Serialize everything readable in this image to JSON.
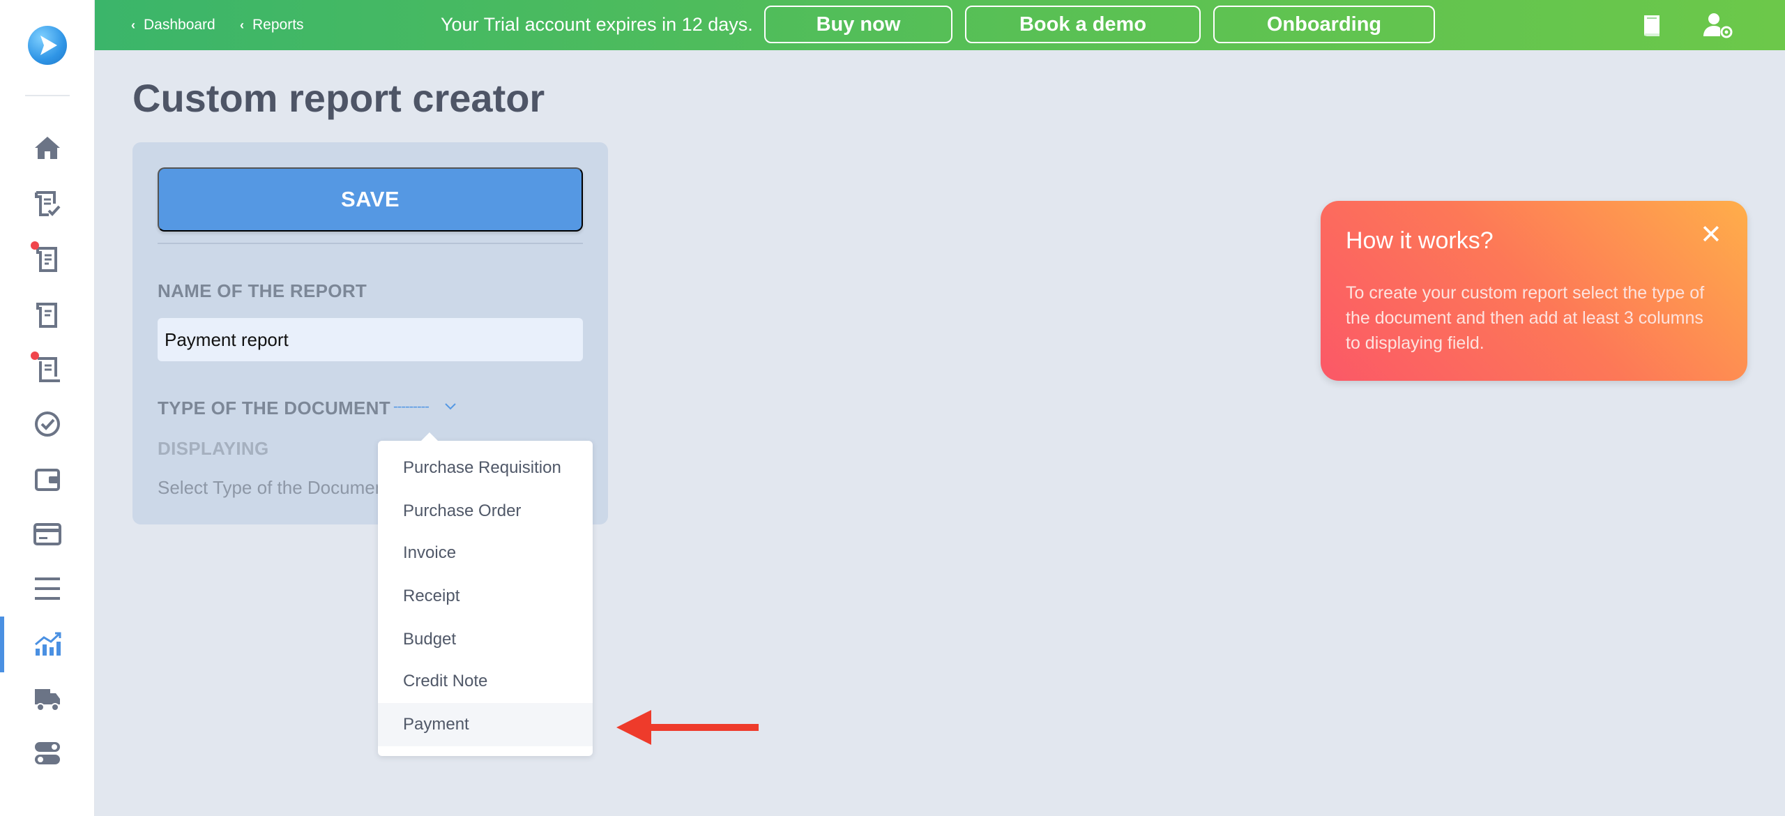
{
  "topbar": {
    "crumbs": [
      "Dashboard",
      "Reports"
    ],
    "trial_text": "Your Trial account expires in 12 days.",
    "buttons": [
      "Buy now",
      "Book a demo",
      "Onboarding"
    ]
  },
  "sidebar": {
    "icons": [
      "home-icon",
      "document-check-icon",
      "document-icon",
      "document-icon",
      "receipt-icon",
      "check-circle-icon",
      "wallet-icon",
      "card-icon",
      "menu-icon",
      "chart-icon",
      "truck-icon",
      "toggle-icon"
    ],
    "active": "chart-icon"
  },
  "page": {
    "title": "Custom report creator"
  },
  "form": {
    "save_label": "SAVE",
    "name_label": "NAME OF THE REPORT",
    "name_value": "Payment report",
    "type_label": "TYPE OF THE DOCUMENT",
    "type_value": "---------",
    "displaying_label": "DISPLAYING",
    "select_hint": "Select Type of the Document"
  },
  "dropdown": {
    "options": [
      "Purchase Requisition",
      "Purchase Order",
      "Invoice",
      "Receipt",
      "Budget",
      "Credit Note",
      "Payment"
    ],
    "highlighted": "Payment"
  },
  "howto": {
    "title": "How it works?",
    "text": "To create your custom report select the type of the document and then add at least 3 columns to displaying field."
  },
  "colors": {
    "accent": "#5598e3",
    "topbar_green": "#4cbb5f",
    "arrow_red": "#ee3b2b",
    "popup_orange": "#fd7857"
  }
}
